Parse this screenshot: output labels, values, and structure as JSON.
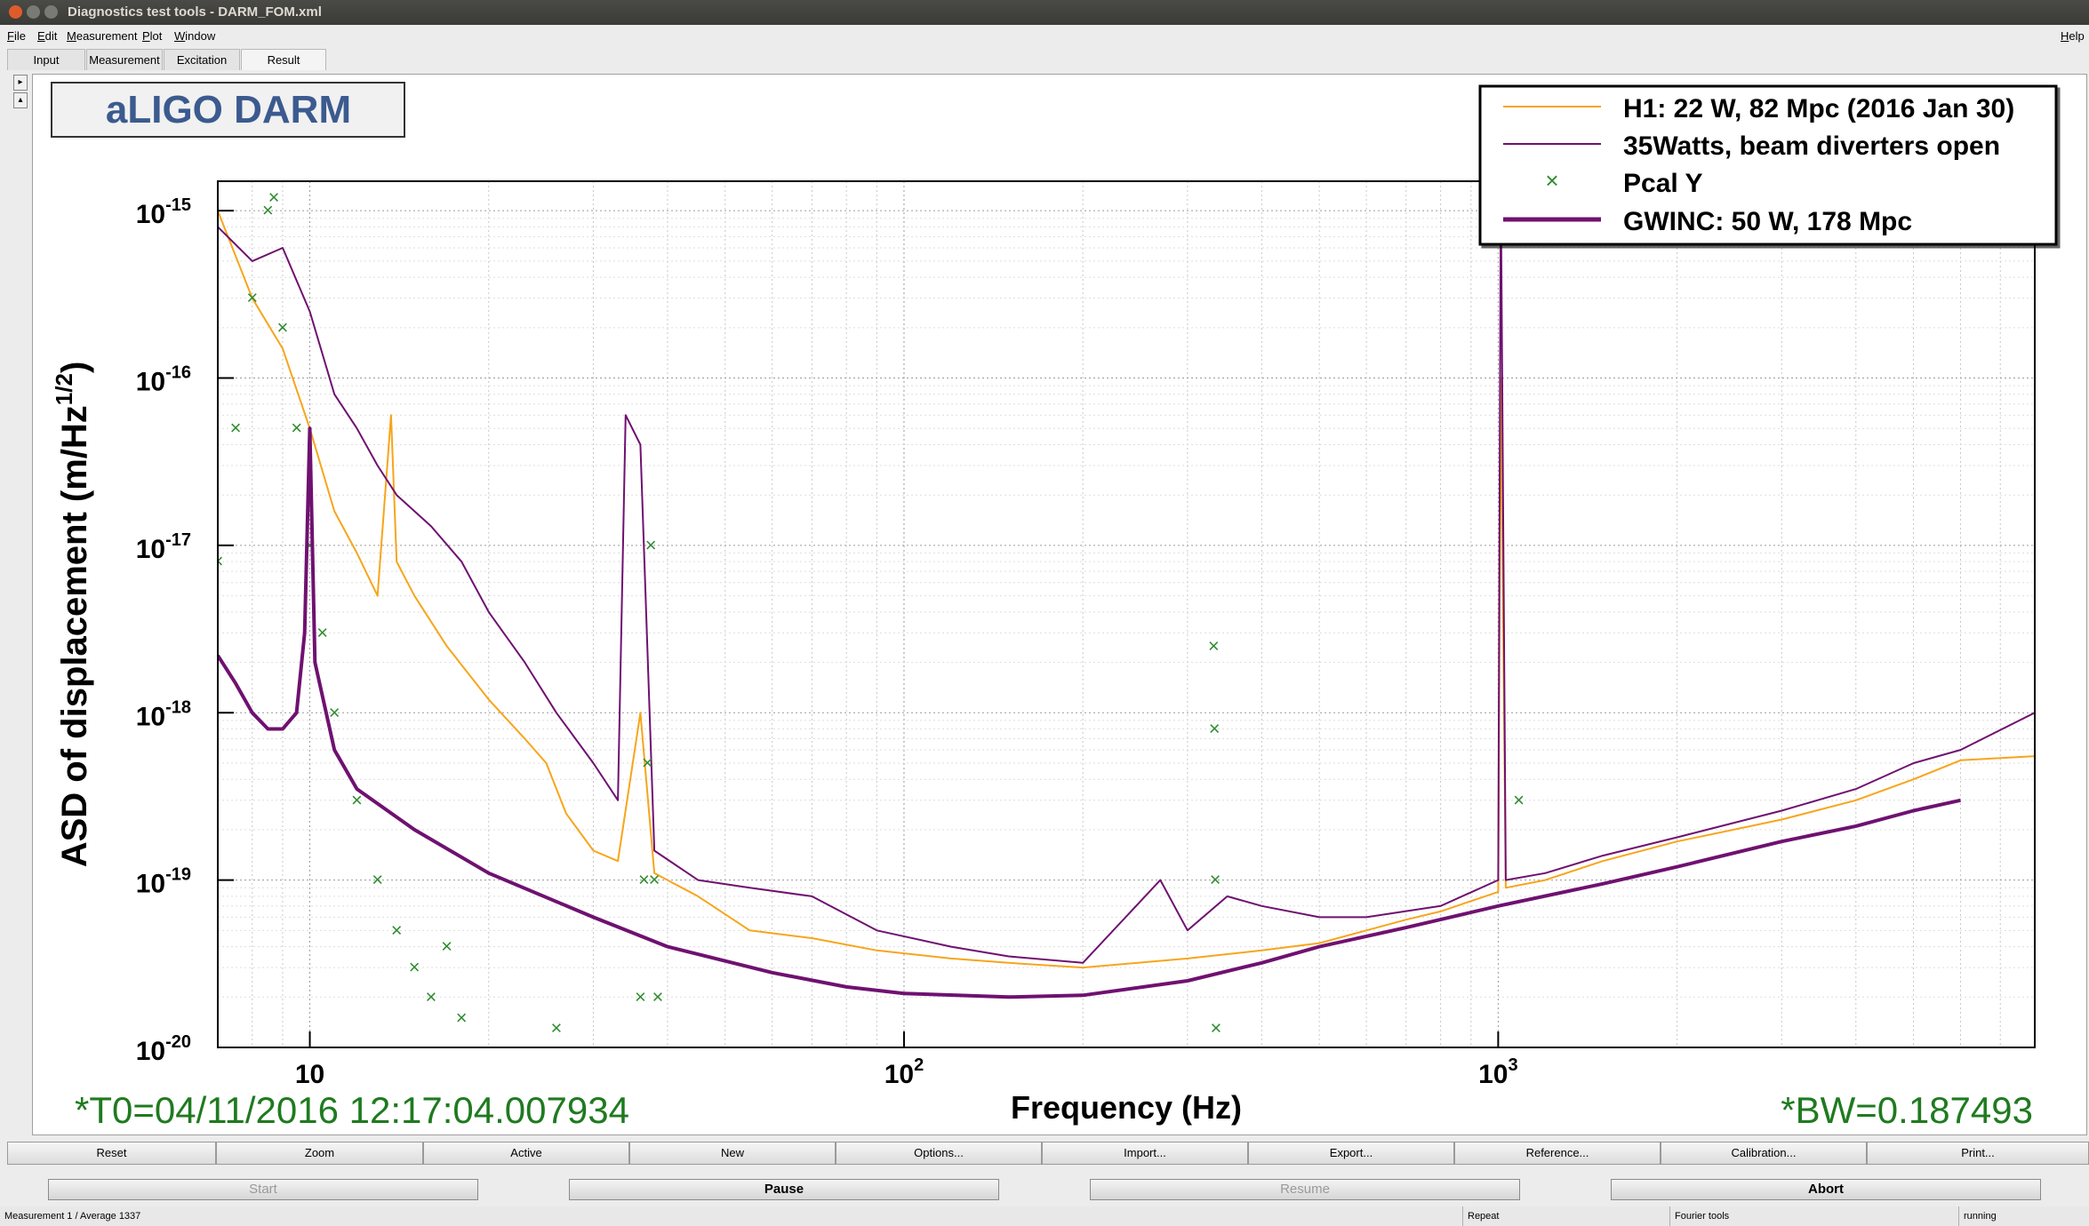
{
  "window": {
    "title": "Diagnostics test tools - DARM_FOM.xml"
  },
  "menu": {
    "items": [
      "File",
      "Edit",
      "Measurement",
      "Plot",
      "Window"
    ],
    "help": "Help"
  },
  "tabs": [
    "Input",
    "Measurement",
    "Excitation",
    "Result"
  ],
  "active_tab": "Result",
  "plot_title_box": "aLIGO DARM",
  "footer": {
    "t0": "*T0=04/11/2016 12:17:04.007934",
    "bw": "*BW=0.187493"
  },
  "toolbar_buttons": [
    "Reset",
    "Zoom",
    "Active",
    "New",
    "Options...",
    "Import...",
    "Export...",
    "Reference...",
    "Calibration...",
    "Print..."
  ],
  "control_buttons": [
    "Start",
    "Pause",
    "Resume",
    "Abort"
  ],
  "status": {
    "left": "Measurement 1 / Average 1337",
    "repeat": "Repeat",
    "fourier": "Fourier tools",
    "state": "running"
  },
  "colors": {
    "h1": "#f7a51b",
    "beam": "#6f1170",
    "pcal": "#2e8b2e",
    "gwinc": "#6f1170",
    "footer_text": "#1f7a1f",
    "title_box_text": "#3b5a8f"
  },
  "chart_data": {
    "type": "line",
    "xlabel": "Frequency (Hz)",
    "ylabel": "ASD of displacement (m/Hz^1/2)",
    "xscale": "log",
    "yscale": "log",
    "xlim": [
      7.0,
      8000
    ],
    "ylim": [
      1e-20,
      1.5e-15
    ],
    "x_ticks": [
      {
        "label": "10",
        "value": 10
      },
      {
        "label": "10",
        "sup": "2",
        "value": 100
      },
      {
        "label": "10",
        "sup": "3",
        "value": 1000
      }
    ],
    "y_ticks": [
      {
        "label": "10",
        "sup": "-15",
        "value": 1e-15
      },
      {
        "label": "10",
        "sup": "-16",
        "value": 1e-16
      },
      {
        "label": "10",
        "sup": "-17",
        "value": 1e-17
      },
      {
        "label": "10",
        "sup": "-18",
        "value": 1e-18
      },
      {
        "label": "10",
        "sup": "-19",
        "value": 1e-19
      },
      {
        "label": "10",
        "sup": "-20",
        "value": 1e-20
      }
    ],
    "grid": true,
    "legend_position": "top-right",
    "series": [
      {
        "name": "H1: 22 W, 82 Mpc (2016 Jan 30)",
        "style": "line",
        "points": [
          [
            7.0,
            1e-15
          ],
          [
            8.0,
            3e-16
          ],
          [
            9.0,
            1.5e-16
          ],
          [
            10,
            5e-17
          ],
          [
            11,
            1.6e-17
          ],
          [
            12,
            9e-18
          ],
          [
            13,
            5e-18
          ],
          [
            13.7,
            6e-17
          ],
          [
            14,
            8e-18
          ],
          [
            15,
            5e-18
          ],
          [
            17,
            2.5e-18
          ],
          [
            20,
            1.2e-18
          ],
          [
            23,
            7e-19
          ],
          [
            25,
            5e-19
          ],
          [
            27,
            2.5e-19
          ],
          [
            30,
            1.5e-19
          ],
          [
            33,
            1.3e-19
          ],
          [
            36,
            1e-18
          ],
          [
            38,
            1.1e-19
          ],
          [
            45,
            8e-20
          ],
          [
            55,
            5e-20
          ],
          [
            70,
            4.5e-20
          ],
          [
            90,
            3.8e-20
          ],
          [
            120,
            3.4e-20
          ],
          [
            150,
            3.2e-20
          ],
          [
            200,
            3e-20
          ],
          [
            300,
            3.4e-20
          ],
          [
            400,
            3.8e-20
          ],
          [
            500,
            4.2e-20
          ],
          [
            600,
            5e-20
          ],
          [
            700,
            5.8e-20
          ],
          [
            800,
            6.5e-20
          ],
          [
            1000,
            8.5e-20
          ],
          [
            1010,
            1e-16
          ],
          [
            1030,
            9e-20
          ],
          [
            1200,
            1e-19
          ],
          [
            1500,
            1.3e-19
          ],
          [
            2000,
            1.7e-19
          ],
          [
            3000,
            2.3e-19
          ],
          [
            4000,
            3e-19
          ],
          [
            5000,
            4e-19
          ],
          [
            6000,
            5.2e-19
          ],
          [
            8000,
            5.5e-19
          ]
        ]
      },
      {
        "name": "35Watts, beam diverters open",
        "style": "line",
        "points": [
          [
            7.0,
            8e-16
          ],
          [
            8.0,
            5e-16
          ],
          [
            9.0,
            6e-16
          ],
          [
            10,
            2.5e-16
          ],
          [
            11,
            8e-17
          ],
          [
            12,
            5e-17
          ],
          [
            13,
            3e-17
          ],
          [
            14,
            2e-17
          ],
          [
            16,
            1.3e-17
          ],
          [
            18,
            8e-18
          ],
          [
            20,
            4e-18
          ],
          [
            23,
            2e-18
          ],
          [
            26,
            1e-18
          ],
          [
            30,
            5e-19
          ],
          [
            33,
            3e-19
          ],
          [
            34,
            6e-17
          ],
          [
            36,
            4e-17
          ],
          [
            38,
            1.5e-19
          ],
          [
            45,
            1e-19
          ],
          [
            55,
            9e-20
          ],
          [
            70,
            8e-20
          ],
          [
            90,
            5e-20
          ],
          [
            120,
            4e-20
          ],
          [
            150,
            3.5e-20
          ],
          [
            200,
            3.2e-20
          ],
          [
            270,
            1e-19
          ],
          [
            300,
            5e-20
          ],
          [
            350,
            8e-20
          ],
          [
            400,
            7e-20
          ],
          [
            500,
            6e-20
          ],
          [
            600,
            6e-20
          ],
          [
            800,
            7e-20
          ],
          [
            1000,
            1e-19
          ],
          [
            1010,
            1.5e-15
          ],
          [
            1030,
            1e-19
          ],
          [
            1200,
            1.1e-19
          ],
          [
            1500,
            1.4e-19
          ],
          [
            2000,
            1.8e-19
          ],
          [
            3000,
            2.6e-19
          ],
          [
            4000,
            3.5e-19
          ],
          [
            5000,
            5e-19
          ],
          [
            6000,
            6e-19
          ],
          [
            8000,
            1e-18
          ]
        ]
      },
      {
        "name": "Pcal Y",
        "style": "markers",
        "points": [
          [
            7.0,
            8e-18
          ],
          [
            7.5,
            5e-17
          ],
          [
            8.0,
            3e-16
          ],
          [
            8.5,
            1e-15
          ],
          [
            8.7,
            1.2e-15
          ],
          [
            9.0,
            2e-16
          ],
          [
            9.5,
            5e-17
          ],
          [
            10,
            1e-17
          ],
          [
            10.5,
            3e-18
          ],
          [
            11,
            1e-18
          ],
          [
            12,
            3e-19
          ],
          [
            13,
            1e-19
          ],
          [
            14,
            5e-20
          ],
          [
            15,
            3e-20
          ],
          [
            16,
            2e-20
          ],
          [
            17,
            4e-20
          ],
          [
            18,
            1.5e-20
          ],
          [
            26,
            1.3e-20
          ],
          [
            36,
            2e-20
          ],
          [
            36.5,
            1e-19
          ],
          [
            37,
            5e-19
          ],
          [
            37.5,
            1e-17
          ],
          [
            38,
            1e-19
          ],
          [
            38.5,
            2e-20
          ],
          [
            332,
            2.5e-18
          ],
          [
            333,
            8e-19
          ],
          [
            334,
            1e-19
          ],
          [
            335,
            1.3e-20
          ],
          [
            1083,
            3e-19
          ]
        ]
      },
      {
        "name": "GWINC: 50 W, 178 Mpc",
        "style": "thick-line",
        "points": [
          [
            7.0,
            2.2e-18
          ],
          [
            7.5,
            1.5e-18
          ],
          [
            8.0,
            1e-18
          ],
          [
            8.5,
            8e-19
          ],
          [
            9.0,
            8e-19
          ],
          [
            9.5,
            1e-18
          ],
          [
            9.8,
            3e-18
          ],
          [
            10,
            5e-17
          ],
          [
            10.2,
            2e-18
          ],
          [
            11,
            6e-19
          ],
          [
            12,
            3.5e-19
          ],
          [
            15,
            2e-19
          ],
          [
            20,
            1.1e-19
          ],
          [
            30,
            6e-20
          ],
          [
            40,
            4e-20
          ],
          [
            60,
            2.8e-20
          ],
          [
            80,
            2.3e-20
          ],
          [
            100,
            2.1e-20
          ],
          [
            150,
            2e-20
          ],
          [
            200,
            2.05e-20
          ],
          [
            300,
            2.5e-20
          ],
          [
            400,
            3.2e-20
          ],
          [
            500,
            4e-20
          ],
          [
            700,
            5.2e-20
          ],
          [
            1000,
            7e-20
          ],
          [
            1500,
            9.5e-20
          ],
          [
            2000,
            1.2e-19
          ],
          [
            3000,
            1.7e-19
          ],
          [
            4000,
            2.1e-19
          ],
          [
            5000,
            2.6e-19
          ],
          [
            6000,
            3e-19
          ]
        ]
      }
    ]
  }
}
